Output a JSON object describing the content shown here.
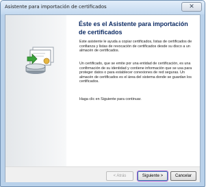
{
  "window": {
    "title": "Asistente para importación de certificados",
    "close_icon": "close-icon"
  },
  "wizard": {
    "heading": "Éste es el Asistente para importación de certificados",
    "paragraph1": "Este asistente le ayuda a copiar certificados, listas de certificados de confianza y listas de revocación de certificados desde su disco a un almacén de certificados.",
    "paragraph2": "Un certificado, que se emite por una entidad de certificación, es una confirmación de su identidad y contiene información que se usa para proteger datos o para establecer conexiones de red seguras. Un almacén de certificados es el área del sistema donde se guardan los certificados.",
    "paragraph3": "Haga clic en Siguiente para continuar."
  },
  "buttons": {
    "back": "< Atrás",
    "next": "Siguiente >",
    "cancel": "Cancelar"
  },
  "colors": {
    "accent": "#0e2c64",
    "focus_ring": "#a85bd1"
  }
}
